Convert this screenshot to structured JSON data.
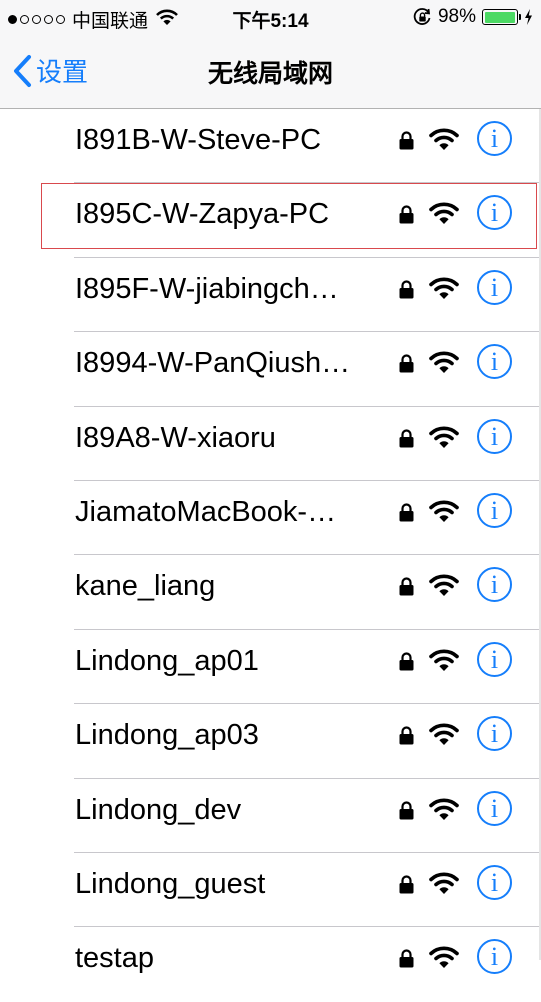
{
  "status_bar": {
    "signal_dots": [
      true,
      false,
      false,
      false,
      false
    ],
    "carrier": "中国联通",
    "time": "下午5:14",
    "battery_percent": "98%",
    "battery_level": 0.98
  },
  "nav": {
    "back_label": "设置",
    "title": "无线局域网"
  },
  "networks": [
    {
      "ssid": "I891B-W-Steve-PC",
      "locked": true
    },
    {
      "ssid": "I895C-W-Zapya-PC",
      "locked": true,
      "highlighted": true
    },
    {
      "ssid": "I895F-W-jiabingch…",
      "locked": true
    },
    {
      "ssid": "I8994-W-PanQiush…",
      "locked": true
    },
    {
      "ssid": "I89A8-W-xiaoru",
      "locked": true
    },
    {
      "ssid": "JiamatoMacBook-…",
      "locked": true
    },
    {
      "ssid": "kane_liang",
      "locked": true
    },
    {
      "ssid": "Lindong_ap01",
      "locked": true
    },
    {
      "ssid": "Lindong_ap03",
      "locked": true
    },
    {
      "ssid": "Lindong_dev",
      "locked": true
    },
    {
      "ssid": "Lindong_guest",
      "locked": true
    },
    {
      "ssid": "testap",
      "locked": true
    }
  ],
  "icons": {
    "info": "i",
    "accent_color": "#157efb",
    "highlight_color": "#d9494d"
  }
}
